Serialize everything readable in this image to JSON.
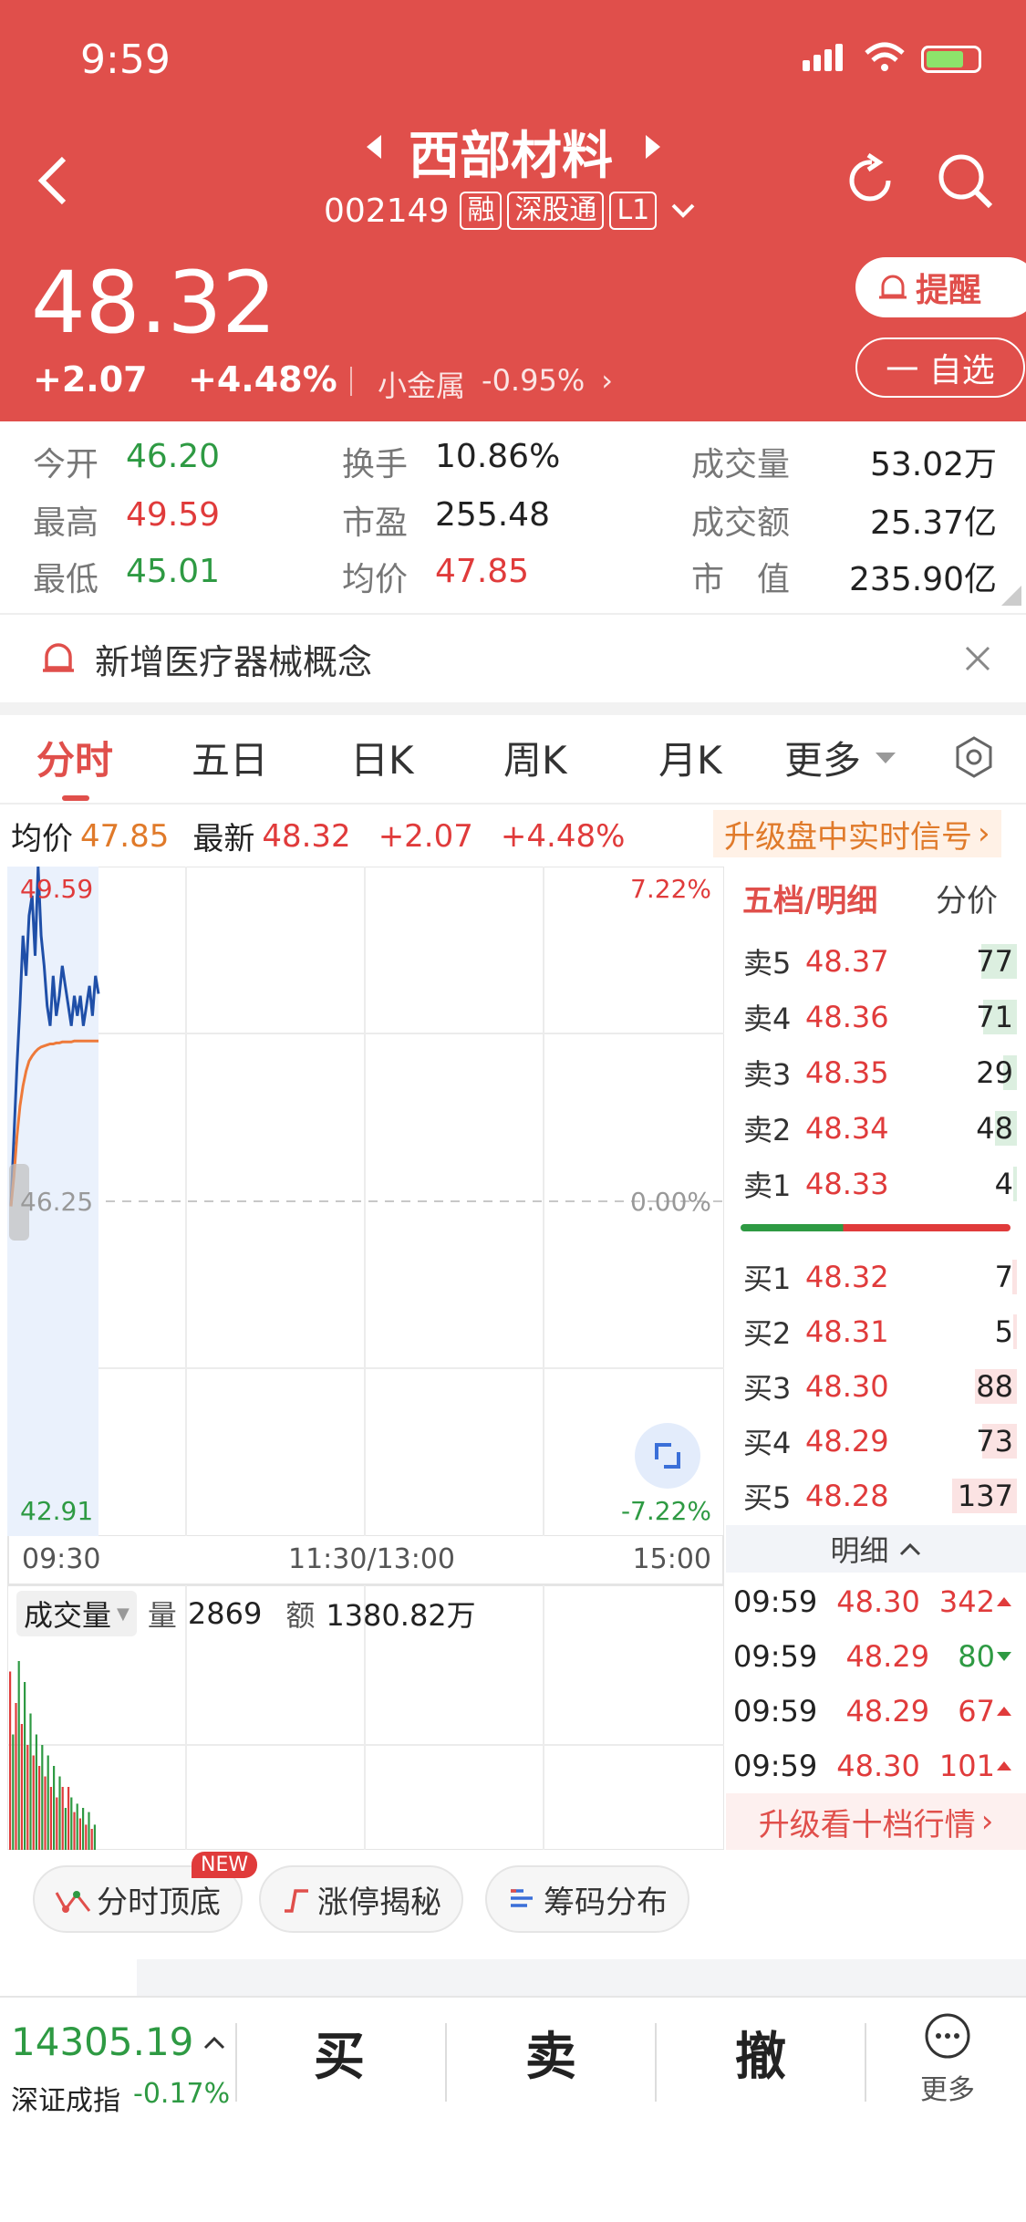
{
  "status_bar": {
    "time": "9:59"
  },
  "header": {
    "stock_name": "西部材料",
    "stock_code": "002149",
    "tags": [
      "融",
      "深股通",
      "L1"
    ],
    "price": "48.32",
    "change": "+2.07",
    "change_pct": "+4.48%",
    "sector": "小金属",
    "sector_change": "-0.95%",
    "remind_label": "提醒",
    "watchlist_label": "一 自选"
  },
  "quote": {
    "open_label": "今开",
    "open": "46.20",
    "high_label": "最高",
    "high": "49.59",
    "low_label": "最低",
    "low": "45.01",
    "turnover_label": "换手",
    "turnover": "10.86%",
    "pe_label": "市盈",
    "pe": "255.48",
    "avg_label": "均价",
    "avg": "47.85",
    "volume_label": "成交量",
    "volume": "53.02万",
    "amount_label": "成交额",
    "amount": "25.37亿",
    "mcap_label": "市　值",
    "mcap": "235.90亿"
  },
  "notice": {
    "text": "新增医疗器械概念"
  },
  "tabs": [
    "分时",
    "五日",
    "日K",
    "周K",
    "月K",
    "更多"
  ],
  "info_bar": {
    "avg_label": "均价",
    "avg": "47.85",
    "latest_label": "最新",
    "latest": "48.32",
    "change": "+2.07",
    "change_pct": "+4.48%",
    "upgrade": "升级盘中实时信号"
  },
  "chart_data": {
    "type": "line",
    "title": "",
    "ylim": [
      42.91,
      49.59
    ],
    "y_labels": {
      "max": "49.59",
      "mid": "46.25",
      "min": "42.91",
      "pct_max": "7.22%",
      "pct_mid": "0.00%",
      "pct_min": "-7.22%"
    },
    "x_labels": [
      "09:30",
      "11:30/13:00",
      "15:00"
    ],
    "series": [
      {
        "name": "",
        "color": "#1f4fa8",
        "x": [
          0,
          1,
          2,
          3,
          4,
          5,
          6,
          7,
          8,
          9,
          10,
          11,
          12,
          13,
          14,
          15,
          16,
          17,
          18,
          19,
          20,
          21,
          22,
          23,
          24,
          25,
          26,
          27,
          28,
          29
        ],
        "values": [
          46.2,
          46.9,
          47.6,
          48.2,
          48.9,
          48.5,
          49.1,
          49.3,
          48.7,
          49.59,
          48.9,
          48.6,
          48.2,
          48.0,
          48.5,
          48.1,
          48.3,
          48.6,
          48.4,
          48.2,
          48.0,
          48.3,
          48.1,
          48.3,
          48.0,
          48.2,
          48.4,
          48.1,
          48.5,
          48.32
        ]
      },
      {
        "name": "",
        "color": "#ee7a3a",
        "x": [
          0,
          1,
          2,
          3,
          4,
          5,
          6,
          7,
          8,
          9,
          10,
          11,
          12,
          13,
          14,
          15,
          16,
          17,
          18,
          19,
          20,
          21,
          22,
          23,
          24,
          25,
          26,
          27,
          28,
          29
        ],
        "values": [
          46.2,
          46.5,
          46.9,
          47.2,
          47.4,
          47.55,
          47.65,
          47.7,
          47.74,
          47.77,
          47.79,
          47.8,
          47.81,
          47.82,
          47.82,
          47.83,
          47.83,
          47.84,
          47.84,
          47.84,
          47.84,
          47.85,
          47.85,
          47.85,
          47.85,
          47.85,
          47.85,
          47.85,
          47.85,
          47.85
        ]
      }
    ]
  },
  "volume": {
    "label": "成交量",
    "vol_label": "量",
    "vol": "2869",
    "amt_label": "额",
    "amt": "1380.82万"
  },
  "volume_bars": [
    0.85,
    0.55,
    0.7,
    0.9,
    0.6,
    0.8,
    0.5,
    0.65,
    0.45,
    0.55,
    0.4,
    0.5,
    0.35,
    0.45,
    0.3,
    0.4,
    0.25,
    0.35,
    0.3,
    0.2,
    0.3,
    0.25,
    0.18,
    0.22,
    0.15,
    0.2,
    0.12,
    0.18,
    0.1,
    0.12
  ],
  "orderbook": {
    "tab_active": "五档/明细",
    "tab_other": "分价",
    "asks": [
      {
        "label": "卖5",
        "price": "48.37",
        "vol": "77",
        "w": 0.32
      },
      {
        "label": "卖4",
        "price": "48.36",
        "vol": "71",
        "w": 0.3
      },
      {
        "label": "卖3",
        "price": "48.35",
        "vol": "29",
        "w": 0.12
      },
      {
        "label": "卖2",
        "price": "48.34",
        "vol": "48",
        "w": 0.2
      },
      {
        "label": "卖1",
        "price": "48.33",
        "vol": "4",
        "w": 0.03
      }
    ],
    "bids": [
      {
        "label": "买1",
        "price": "48.32",
        "vol": "7",
        "w": 0.04
      },
      {
        "label": "买2",
        "price": "48.31",
        "vol": "5",
        "w": 0.03
      },
      {
        "label": "买3",
        "price": "48.30",
        "vol": "88",
        "w": 0.38
      },
      {
        "label": "买4",
        "price": "48.29",
        "vol": "73",
        "w": 0.31
      },
      {
        "label": "买5",
        "price": "48.28",
        "vol": "137",
        "w": 0.58
      }
    ]
  },
  "ticks": {
    "header": "明细",
    "rows": [
      {
        "time": "09:59",
        "price": "48.30",
        "vol": "342",
        "dir": "up"
      },
      {
        "time": "09:59",
        "price": "48.29",
        "vol": "80",
        "dir": "down"
      },
      {
        "time": "09:59",
        "price": "48.29",
        "vol": "67",
        "dir": "up"
      },
      {
        "time": "09:59",
        "price": "48.30",
        "vol": "101",
        "dir": "up"
      }
    ],
    "upgrade": "升级看十档行情"
  },
  "tools": [
    {
      "label": "分时顶底",
      "badge": "NEW"
    },
    {
      "label": "涨停揭秘"
    },
    {
      "label": "筹码分布"
    }
  ],
  "bottom": {
    "index_value": "14305.19",
    "index_name": "深证成指",
    "index_change": "-0.17%",
    "buy": "买",
    "sell": "卖",
    "cancel": "撤",
    "more": "更多"
  }
}
